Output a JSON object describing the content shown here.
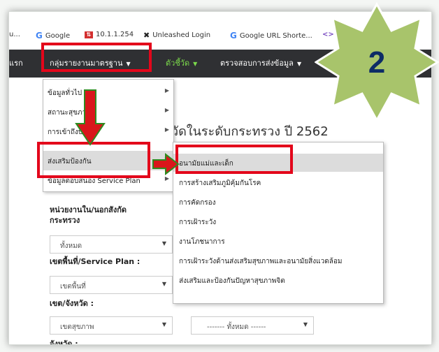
{
  "bookmarks": [
    {
      "label": "u...",
      "icon": "folder-icon"
    },
    {
      "label": "Google",
      "icon": "google-icon"
    },
    {
      "label": "10.1.1.254",
      "icon": "network-icon"
    },
    {
      "label": "Unleashed Login",
      "icon": "unleashed-icon"
    },
    {
      "label": "Google URL Shorte...",
      "icon": "google-icon"
    },
    {
      "label": "In",
      "icon": "code-icon"
    }
  ],
  "nav": {
    "home_partial": "แรก",
    "standard_reports": "กลุ่มรายงานมาตรฐาน",
    "indicators": "ตัวชี้วัด",
    "data_check": "ตรวจสอบการส่งข้อมูล"
  },
  "page": {
    "title_partial": "วัดในระดับกระทรวง ปี 2562"
  },
  "menu_level1": [
    {
      "label": "ข้อมูลทั่วไป"
    },
    {
      "label": "สถานะสุขภาพ"
    },
    {
      "label": "การเข้าถึงบริการ"
    },
    {
      "label": "ส่งเสริมป้องกัน"
    },
    {
      "label": "ข้อมูลตอบสนอง Service Plan"
    }
  ],
  "menu_level2": [
    {
      "label": "อนามัยแม่และเด็ก"
    },
    {
      "label": "การสร้างเสริมภูมิคุ้มกันโรค"
    },
    {
      "label": "การคัดกรอง"
    },
    {
      "label": "การเฝ้าระวัง"
    },
    {
      "label": "งานโภชนาการ"
    },
    {
      "label": "การเฝ้าระวังด้านส่งเสริมสุขภาพและอนามัยสิ่งแวดล้อม"
    },
    {
      "label": "ส่งเสริมและป้องกันปัญหาสุขภาพจิต"
    }
  ],
  "form": {
    "unit_label_1": "หน่วยงานใน/นอกสังกัด",
    "unit_label_2": "กระทรวง",
    "unit_value": "ทั้งหมด",
    "area_label": "เขตพื้นที่/Service Plan :",
    "area_value": "เขตพื้นที่",
    "region_label": "เขต/จังหวัด :",
    "region_value": "เขตสุขภาพ",
    "all_value": "------- ทั้งหมด ------",
    "province_label": "จังหวัด :"
  },
  "callout": {
    "number": "2"
  },
  "colors": {
    "navbar": "#2f3033",
    "nav_green": "#7bd94b",
    "highlight": "#e3061b",
    "arrow_red": "#d9161b",
    "arrow_green_border": "#2e8b1f",
    "star_fill": "#a8c46b",
    "star_text": "#0d2c66"
  }
}
